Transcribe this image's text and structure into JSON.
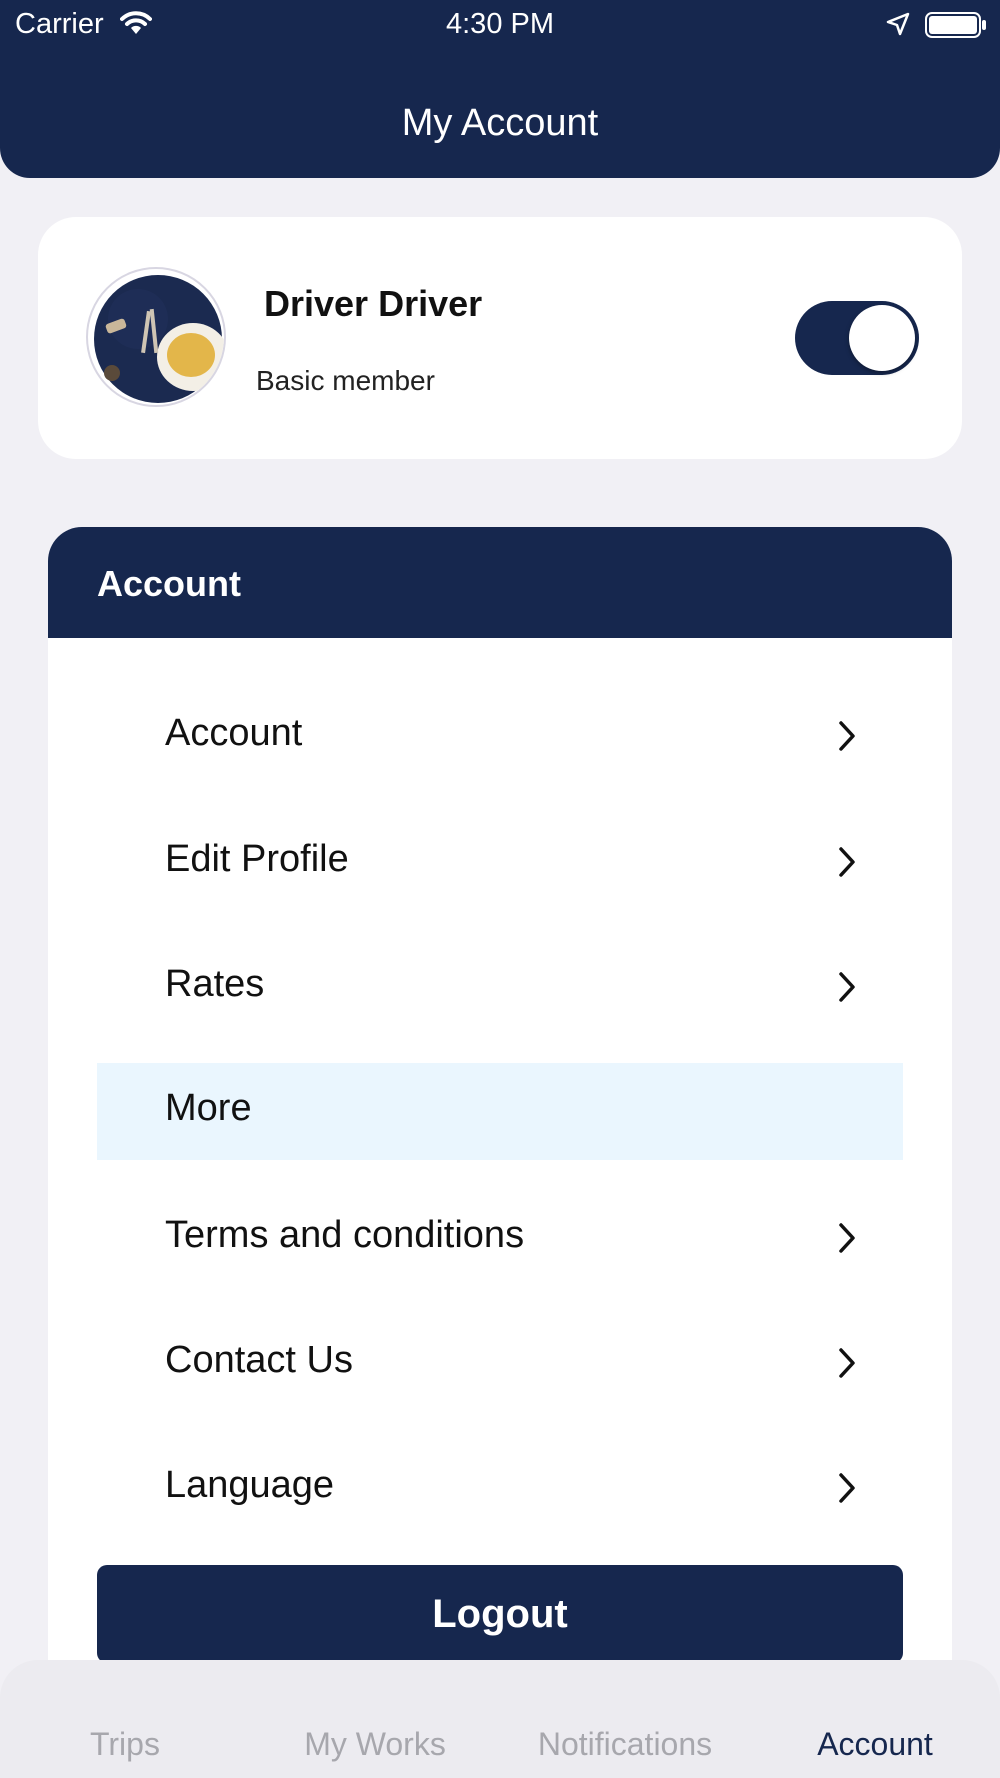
{
  "status_bar": {
    "carrier": "Carrier",
    "time": "4:30 PM",
    "icons": [
      "wifi-icon",
      "location-arrow-icon",
      "battery-icon"
    ]
  },
  "header": {
    "title": "My Account"
  },
  "profile": {
    "name": "Driver Driver",
    "membership": "Basic member",
    "availability_toggle_on": true
  },
  "account_section": {
    "title": "Account",
    "items": [
      {
        "label": "Account",
        "chevron": true
      },
      {
        "label": "Edit Profile",
        "chevron": true
      },
      {
        "label": "Rates",
        "chevron": true
      },
      {
        "label": "More",
        "chevron": false,
        "highlighted": true
      },
      {
        "label": "Terms and conditions",
        "chevron": true
      },
      {
        "label": "Contact Us",
        "chevron": true
      },
      {
        "label": "Language",
        "chevron": true
      }
    ],
    "logout_label": "Logout"
  },
  "tabs": [
    {
      "label": "Trips",
      "active": false
    },
    {
      "label": "My Works",
      "active": false
    },
    {
      "label": "Notifications",
      "active": false
    },
    {
      "label": "Account",
      "active": true
    }
  ],
  "colors": {
    "primary": "#16274e",
    "background": "#f1f0f5",
    "highlight": "#eaf6fe",
    "tab_inactive": "#a7a7ad"
  }
}
